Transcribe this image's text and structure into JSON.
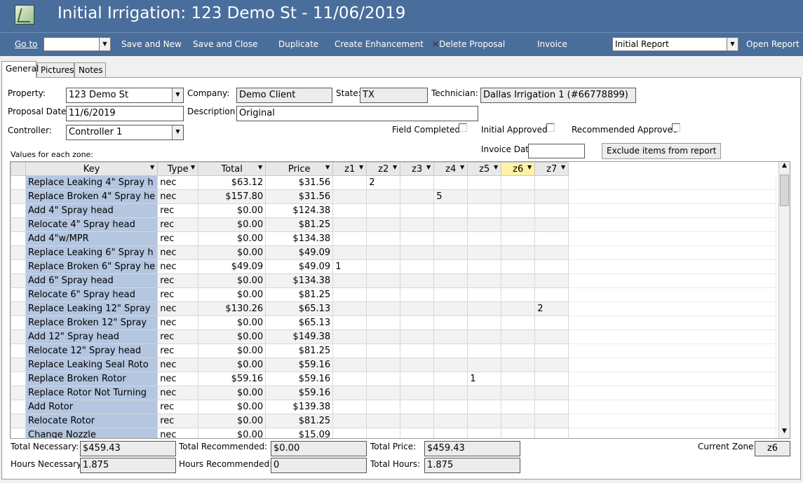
{
  "window": {
    "title": "Initial Irrigation: 123 Demo St - 11/06/2019"
  },
  "toolbar": {
    "goto_label": "Go to",
    "goto_value": "",
    "save_new": "Save and New",
    "save_close": "Save and Close",
    "duplicate": "Duplicate",
    "create_enhancement": "Create Enhancement",
    "delete_proposal": "Delete Proposal",
    "invoice": "Invoice",
    "report_select": "Initial Report",
    "open_report": "Open Report"
  },
  "tabs": [
    "General",
    "Pictures",
    "Notes"
  ],
  "form": {
    "property_label": "Property:",
    "property_value": "123 Demo St",
    "company_label": "Company:",
    "company_value": "Demo Client",
    "state_label": "State:",
    "state_value": "TX",
    "technician_label": "Technician:",
    "technician_value": "Dallas Irrigation 1 (#66778899)",
    "proposal_date_label": "Proposal Date:",
    "proposal_date_value": "11/6/2019",
    "description_label": "Description:",
    "description_value": "Original",
    "controller_label": "Controller:",
    "controller_value": "Controller 1",
    "field_completed_label": "Field Completed",
    "initial_approved_label": "Initial Approved",
    "recommended_approved_label": "Recommended Approved",
    "invoice_date_label": "Invoice Date",
    "invoice_date_value": "",
    "exclude_button": "Exclude items from report",
    "values_caption": "Values for each zone:"
  },
  "grid": {
    "columns": [
      "Key",
      "Type",
      "Total",
      "Price",
      "z1",
      "z2",
      "z3",
      "z4",
      "z5",
      "z6",
      "z7"
    ],
    "rows": [
      [
        "Replace Leaking 4\" Spray h",
        "nec",
        "$63.12",
        "$31.56",
        "",
        "2",
        "",
        "",
        "",
        "",
        ""
      ],
      [
        "Replace Broken 4\" Spray he",
        "nec",
        "$157.80",
        "$31.56",
        "",
        "",
        "",
        "5",
        "",
        "",
        ""
      ],
      [
        "Add 4\" Spray head",
        "rec",
        "$0.00",
        "$124.38",
        "",
        "",
        "",
        "",
        "",
        "",
        ""
      ],
      [
        "Relocate 4\" Spray head",
        "rec",
        "$0.00",
        "$81.25",
        "",
        "",
        "",
        "",
        "",
        "",
        ""
      ],
      [
        "Add 4\"w/MPR",
        "rec",
        "$0.00",
        "$134.38",
        "",
        "",
        "",
        "",
        "",
        "",
        ""
      ],
      [
        "Replace Leaking 6\" Spray h",
        "nec",
        "$0.00",
        "$49.09",
        "",
        "",
        "",
        "",
        "",
        "",
        ""
      ],
      [
        "Replace Broken 6\" Spray he",
        "nec",
        "$49.09",
        "$49.09",
        "1",
        "",
        "",
        "",
        "",
        "",
        ""
      ],
      [
        "Add 6\" Spray head",
        "rec",
        "$0.00",
        "$134.38",
        "",
        "",
        "",
        "",
        "",
        "",
        ""
      ],
      [
        "Relocate 6\" Spray head",
        "rec",
        "$0.00",
        "$81.25",
        "",
        "",
        "",
        "",
        "",
        "",
        ""
      ],
      [
        "Replace Leaking 12\" Spray",
        "nec",
        "$130.26",
        "$65.13",
        "",
        "",
        "",
        "",
        "",
        "",
        "2"
      ],
      [
        "Replace Broken 12\" Spray",
        "nec",
        "$0.00",
        "$65.13",
        "",
        "",
        "",
        "",
        "",
        "",
        ""
      ],
      [
        "Add 12\" Spray head",
        "rec",
        "$0.00",
        "$149.38",
        "",
        "",
        "",
        "",
        "",
        "",
        ""
      ],
      [
        "Relocate 12\" Spray head",
        "rec",
        "$0.00",
        "$81.25",
        "",
        "",
        "",
        "",
        "",
        "",
        ""
      ],
      [
        "Replace Leaking Seal Roto",
        "nec",
        "$0.00",
        "$59.16",
        "",
        "",
        "",
        "",
        "",
        "",
        ""
      ],
      [
        "Replace Broken Rotor",
        "nec",
        "$59.16",
        "$59.16",
        "",
        "",
        "",
        "",
        "1",
        "",
        ""
      ],
      [
        "Replace Rotor Not Turning",
        "nec",
        "$0.00",
        "$59.16",
        "",
        "",
        "",
        "",
        "",
        "",
        ""
      ],
      [
        "Add Rotor",
        "rec",
        "$0.00",
        "$139.38",
        "",
        "",
        "",
        "",
        "",
        "",
        ""
      ],
      [
        "Relocate Rotor",
        "rec",
        "$0.00",
        "$81.25",
        "",
        "",
        "",
        "",
        "",
        "",
        ""
      ],
      [
        "Change Nozzle",
        "nec",
        "$0.00",
        "$15.09",
        "",
        "",
        "",
        "",
        "",
        "",
        ""
      ]
    ]
  },
  "totals": {
    "total_necessary_label": "Total Necessary:",
    "total_necessary": "$459.43",
    "total_recommended_label": "Total Recommended:",
    "total_recommended": "$0.00",
    "total_price_label": "Total Price:",
    "total_price": "$459.43",
    "current_zone_label": "Current Zone:",
    "current_zone": "z6",
    "hours_necessary_label": "Hours Necessary:",
    "hours_necessary": "1.875",
    "hours_recommended_label": "Hours Recommended:",
    "hours_recommended": "0",
    "total_hours_label": "Total Hours:",
    "total_hours": "1.875"
  }
}
